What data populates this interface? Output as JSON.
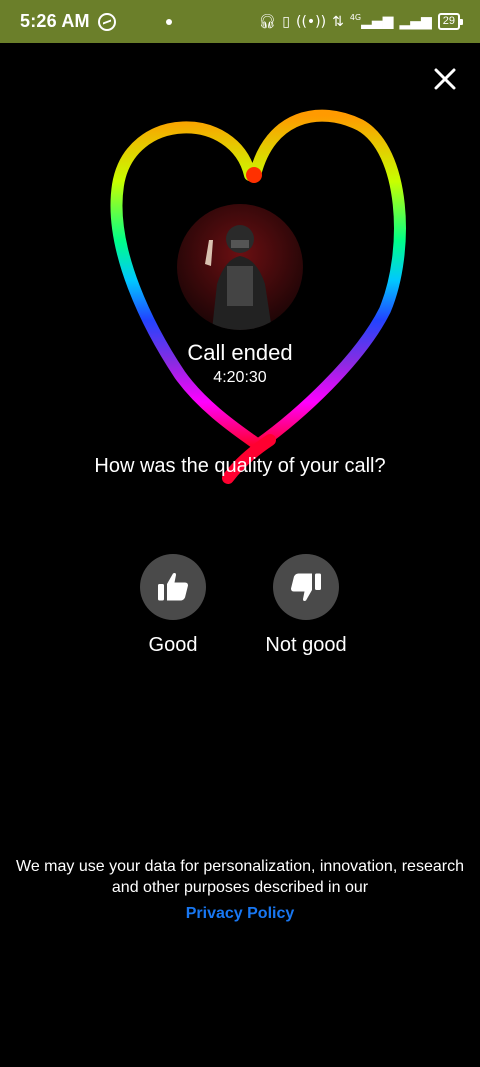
{
  "status_bar": {
    "time": "5:26 AM",
    "icons": [
      "messenger-icon",
      "headphones-icon",
      "vibrate-icon",
      "hotspot-icon",
      "data-arrows-icon",
      "signal-4g-icon",
      "signal-icon",
      "battery-icon"
    ],
    "network": "4G",
    "battery": "29"
  },
  "call": {
    "title": "Call ended",
    "duration": "4:20:30"
  },
  "rating": {
    "question": "How was the quality of your call?",
    "good_label": "Good",
    "not_good_label": "Not good"
  },
  "footer": {
    "line1": "We may use your data for personalization, innovation, research",
    "line2": "and other purposes described in our",
    "privacy_link": "Privacy Policy"
  },
  "colors": {
    "status_bar": "#6b7f2a",
    "button_bg": "#4a4a4a",
    "link": "#1877f2"
  }
}
